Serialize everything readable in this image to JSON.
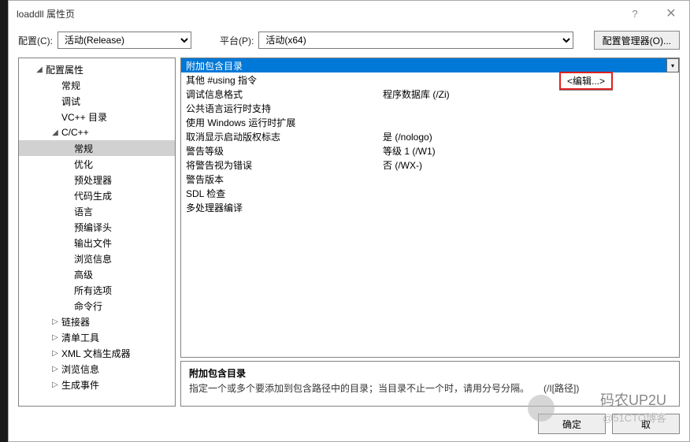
{
  "window": {
    "title": "loaddll 属性页",
    "help": "?",
    "close": "✕"
  },
  "toolbar": {
    "config_label": "配置(C):",
    "config_value": "活动(Release)",
    "platform_label": "平台(P):",
    "platform_value": "活动(x64)",
    "config_mgr": "配置管理器(O)..."
  },
  "tree": [
    {
      "label": "配置属性",
      "depth": 1,
      "exp": true
    },
    {
      "label": "常规",
      "depth": 2
    },
    {
      "label": "调试",
      "depth": 2
    },
    {
      "label": "VC++ 目录",
      "depth": 2
    },
    {
      "label": "C/C++",
      "depth": 2,
      "exp": true
    },
    {
      "label": "常规",
      "depth": 3,
      "sel": true
    },
    {
      "label": "优化",
      "depth": 3
    },
    {
      "label": "预处理器",
      "depth": 3
    },
    {
      "label": "代码生成",
      "depth": 3
    },
    {
      "label": "语言",
      "depth": 3
    },
    {
      "label": "预编译头",
      "depth": 3
    },
    {
      "label": "输出文件",
      "depth": 3
    },
    {
      "label": "浏览信息",
      "depth": 3
    },
    {
      "label": "高级",
      "depth": 3
    },
    {
      "label": "所有选项",
      "depth": 3
    },
    {
      "label": "命令行",
      "depth": 3
    },
    {
      "label": "链接器",
      "depth": 2,
      "col": true
    },
    {
      "label": "清单工具",
      "depth": 2,
      "col": true
    },
    {
      "label": "XML 文档生成器",
      "depth": 2,
      "col": true
    },
    {
      "label": "浏览信息",
      "depth": 2,
      "col": true
    },
    {
      "label": "生成事件",
      "depth": 2,
      "col": true
    }
  ],
  "grid": [
    {
      "name": "附加包含目录",
      "value": "",
      "hl": true
    },
    {
      "name": "其他 #using 指令",
      "value": ""
    },
    {
      "name": "调试信息格式",
      "value": "程序数据库 (/Zi)"
    },
    {
      "name": "公共语言运行时支持",
      "value": ""
    },
    {
      "name": "使用 Windows 运行时扩展",
      "value": ""
    },
    {
      "name": "取消显示启动版权标志",
      "value": "是 (/nologo)"
    },
    {
      "name": "警告等级",
      "value": "等级 1 (/W1)"
    },
    {
      "name": "将警告视为错误",
      "value": "否 (/WX-)"
    },
    {
      "name": "警告版本",
      "value": ""
    },
    {
      "name": "SDL 检查",
      "value": ""
    },
    {
      "name": "多处理器编译",
      "value": ""
    }
  ],
  "edit_dropdown": "<编辑...>",
  "desc": {
    "title": "附加包含目录",
    "body": "指定一个或多个要添加到包含路径中的目录；当目录不止一个时，请用分号分隔。　　(/I[路径])"
  },
  "footer": {
    "ok": "确定",
    "cancel": "取"
  },
  "watermark": {
    "line1": "码农UP2U",
    "line2": "@51CTO博客"
  }
}
